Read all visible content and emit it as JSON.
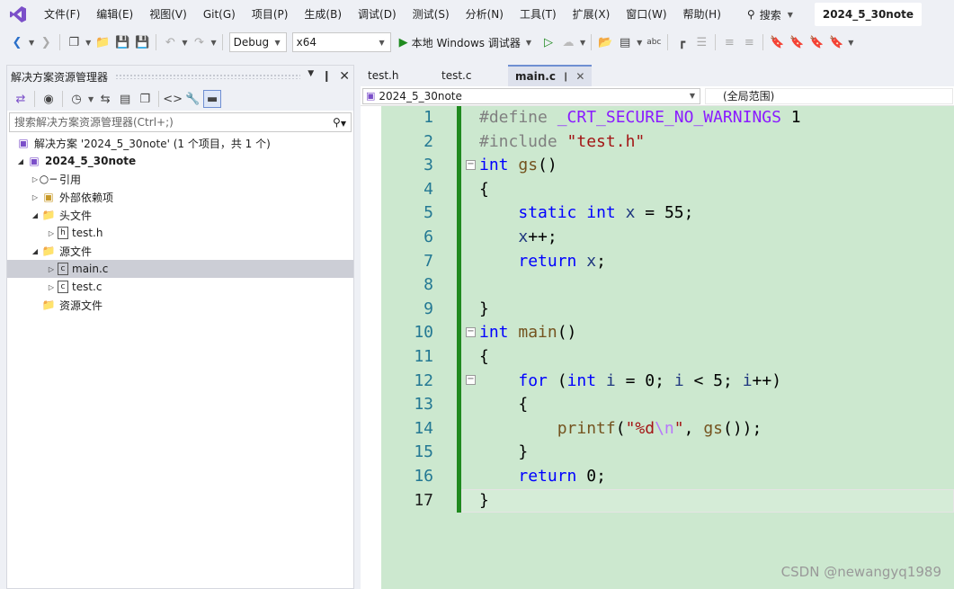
{
  "menu": {
    "items": [
      "文件(F)",
      "编辑(E)",
      "视图(V)",
      "Git(G)",
      "项目(P)",
      "生成(B)",
      "调试(D)",
      "测试(S)",
      "分析(N)",
      "工具(T)",
      "扩展(X)",
      "窗口(W)",
      "帮助(H)"
    ],
    "search_label": "搜索",
    "solution_name": "2024_5_30note"
  },
  "toolbar": {
    "configuration": "Debug",
    "platform": "x64",
    "run_label": "本地 Windows 调试器"
  },
  "solution_explorer": {
    "title": "解决方案资源管理器",
    "search_placeholder": "搜索解决方案资源管理器(Ctrl+;)",
    "tree": [
      {
        "label": "解决方案 '2024_5_30note' (1 个项目，共 1 个)"
      },
      {
        "label": "2024_5_30note"
      },
      {
        "label": "引用"
      },
      {
        "label": "外部依赖项"
      },
      {
        "label": "头文件"
      },
      {
        "label": "test.h"
      },
      {
        "label": "源文件"
      },
      {
        "label": "main.c"
      },
      {
        "label": "test.c"
      },
      {
        "label": "资源文件"
      }
    ]
  },
  "editor": {
    "tabs": [
      {
        "label": "test.h"
      },
      {
        "label": "test.c"
      },
      {
        "label": "main.c"
      }
    ],
    "nav_project": "2024_5_30note",
    "nav_scope": "(全局范围)",
    "line_numbers": [
      "1",
      "2",
      "3",
      "4",
      "5",
      "6",
      "7",
      "8",
      "9",
      "10",
      "11",
      "12",
      "13",
      "14",
      "15",
      "16",
      "17"
    ],
    "current_line": 17,
    "code": {
      "l1_directive": "#define",
      "l1_macro": "_CRT_SECURE_NO_WARNINGS",
      "l1_value": "1",
      "l2_directive": "#include",
      "l2_file": "\"test.h\"",
      "l3_type": "int",
      "l3_name": "gs",
      "l3_rest": "()",
      "l4": "{",
      "l5_static": "static",
      "l5_type": "int",
      "l5_var": "x",
      "l5_rest": "= 55;",
      "l6_var": "x",
      "l6_rest": "++;",
      "l7_kw": "return",
      "l7_var": "x",
      "l7_rest": ";",
      "l9": "}",
      "l10_type": "int",
      "l10_name": "main",
      "l10_rest": "()",
      "l11": "{",
      "l12_for": "for",
      "l12_p1": "(",
      "l12_type": "int",
      "l12_i1": "i",
      "l12_p2": "= 0;",
      "l12_i2": "i",
      "l12_p3": "< 5;",
      "l12_i3": "i",
      "l12_p4": "++)",
      "l13": "{",
      "l14_fn": "printf",
      "l14_p1": "(",
      "l14_s1": "\"%d",
      "l14_esc": "\\n",
      "l14_s2": "\"",
      "l14_p2": ",",
      "l14_fn2": "gs",
      "l14_p3": "());",
      "l15": "}",
      "l16_kw": "return",
      "l16_rest": "0;",
      "l17": "}"
    }
  },
  "watermark": "CSDN @newangyq1989",
  "colors": {
    "editor_background": "#cce8cf",
    "change_bar": "#1f8a1f",
    "keyword": "#0000ff",
    "string": "#a31515",
    "macro": "#8a1bff",
    "line_number": "#237893"
  }
}
